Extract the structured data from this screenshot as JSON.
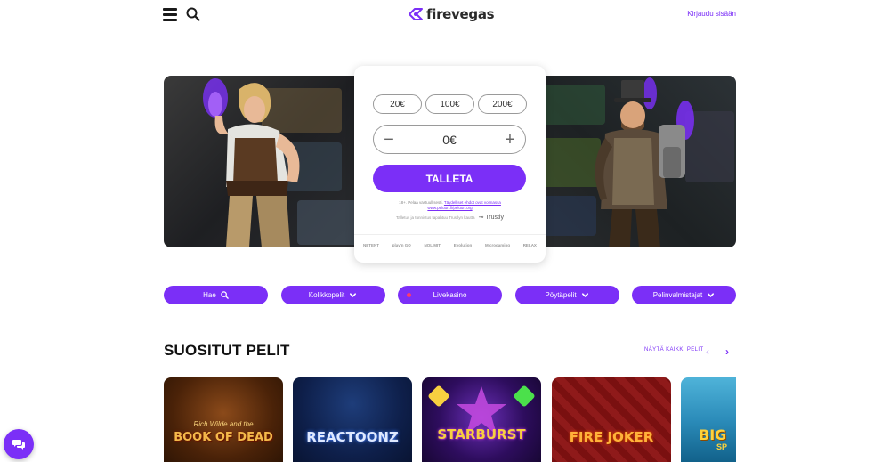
{
  "header": {
    "logo_text": "firevegas",
    "login_label": "Kirjaudu sisään"
  },
  "deposit": {
    "amounts": [
      "20€",
      "100€",
      "200€"
    ],
    "value": "0€",
    "deposit_label": "TALLETA",
    "fine_print": "18+. Pelaa vastuullisesti.",
    "terms_link": "Täydelliset ehdot ovat voimassa",
    "help_link": "www.peluuri.fi/peluuri.org",
    "trustly_note": "Talletus ja tunnistus tapahtuu Trustlyn kautta",
    "trustly_logo": "Trustly",
    "providers": [
      "NETENT",
      "play'n GO",
      "NOLIMIT",
      "Evolution",
      "Microgaming",
      "RELAX"
    ]
  },
  "categories": {
    "search": "Hae",
    "slots": "Kolikkopelit",
    "live": "Livekasino",
    "table": "Pöytäpelit",
    "providers": "Pelinvalmistajat"
  },
  "popular": {
    "title": "SUOSITUT PELIT",
    "see_all": "NÄYTÄ KAIKKI PELIT",
    "games": [
      {
        "title": "BOOK OF DEAD",
        "subtitle": "Rich Wilde and the"
      },
      {
        "title": "REACTOONZ"
      },
      {
        "title": "STARBURST"
      },
      {
        "title": "FIRE JOKER"
      },
      {
        "title": "BIG",
        "subtitle": "SP"
      }
    ]
  },
  "colors": {
    "accent": "#7b2ff7",
    "live_dot": "#ff3b6b"
  }
}
